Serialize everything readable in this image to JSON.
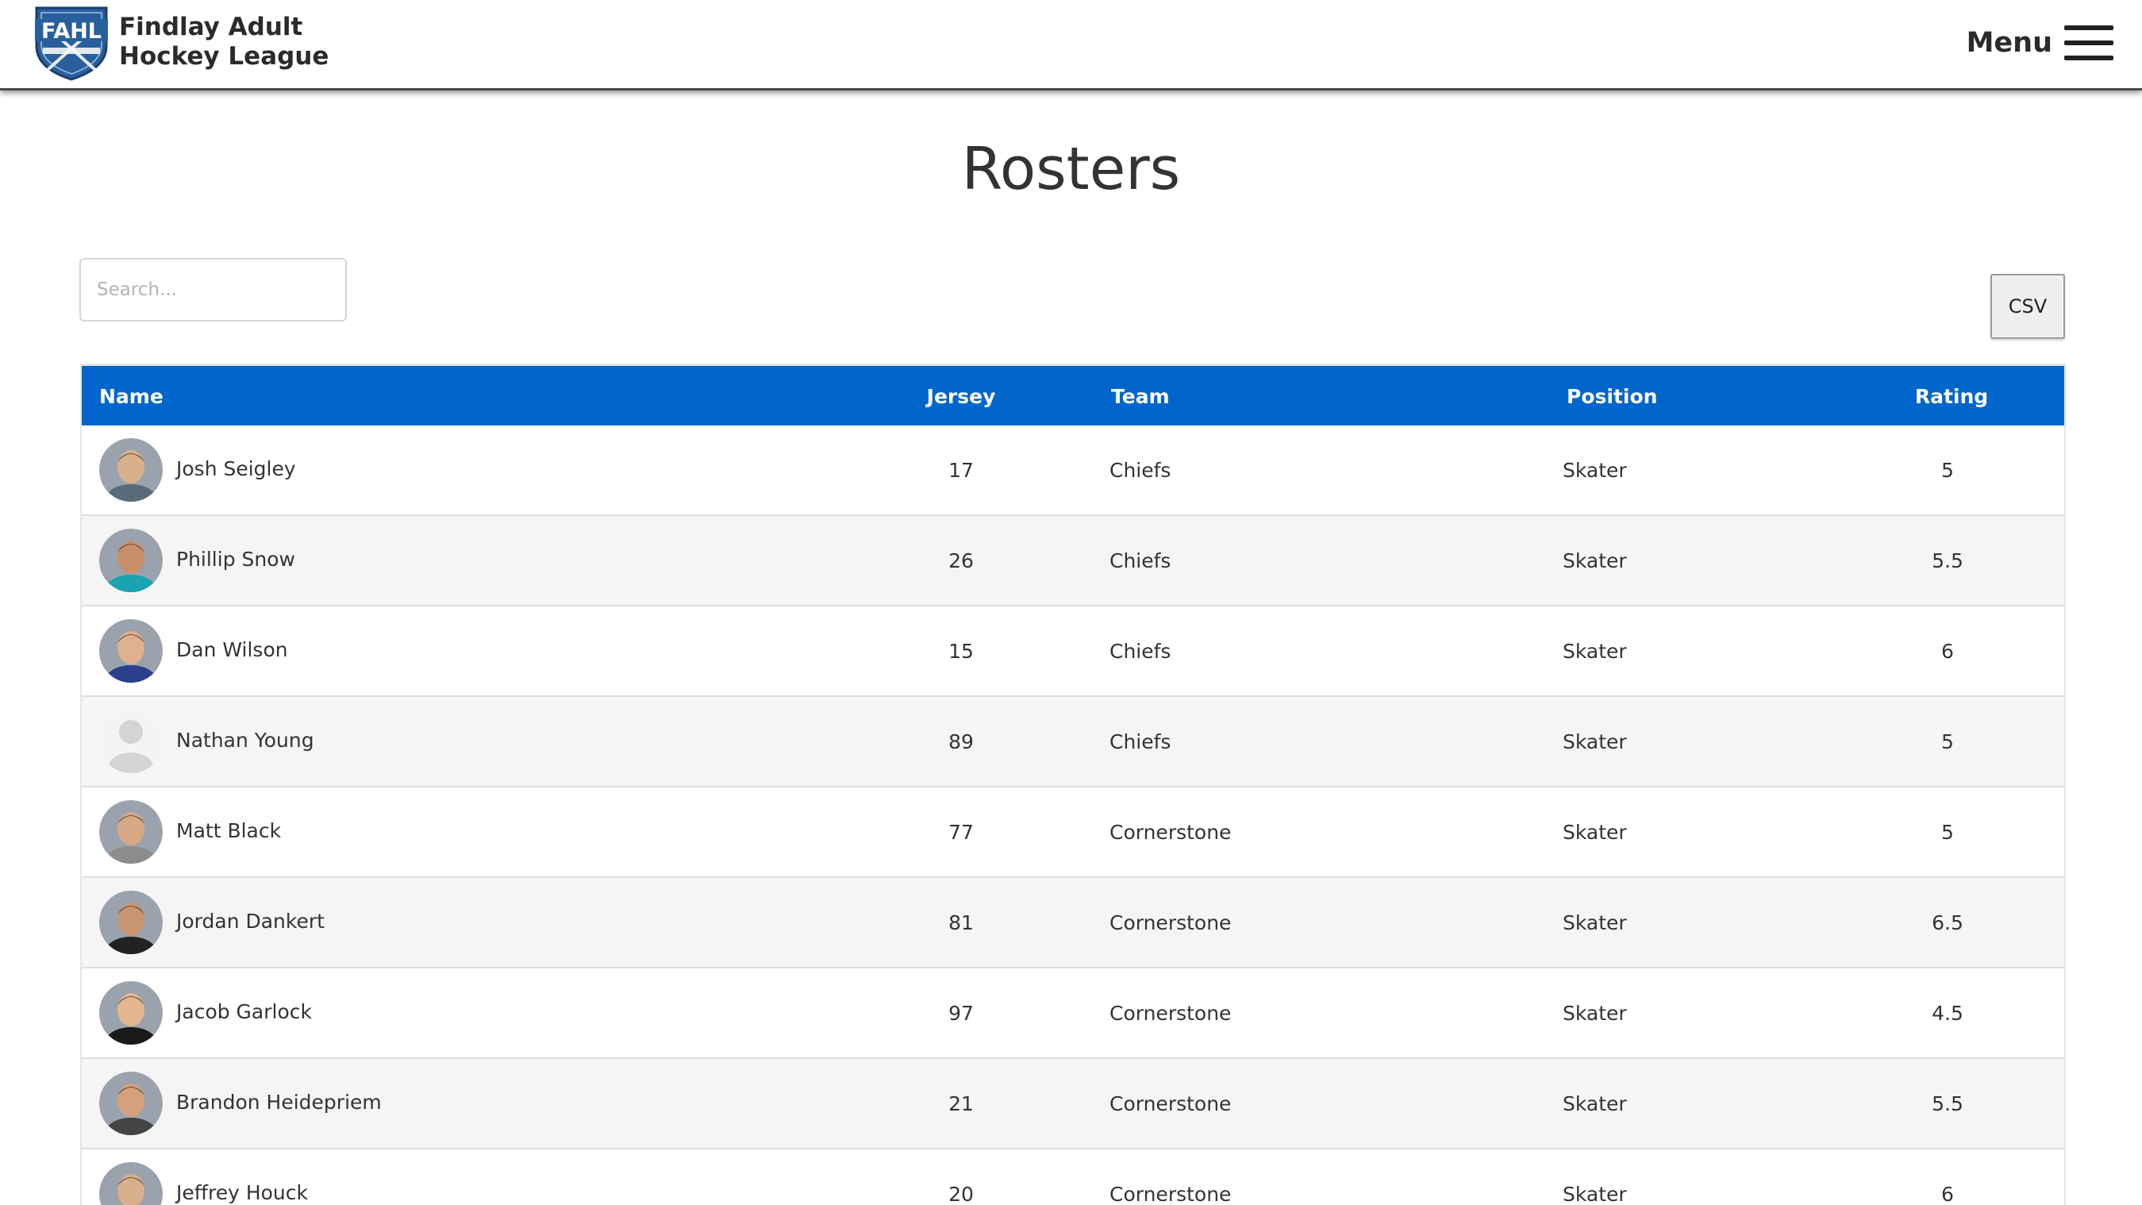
{
  "header": {
    "logo_text": "FAHL",
    "brand_line1": "Findlay Adult",
    "brand_line2": "Hockey League",
    "menu_label": "Menu"
  },
  "page": {
    "title": "Rosters"
  },
  "search": {
    "placeholder": "Search...",
    "value": ""
  },
  "actions": {
    "csv_label": "CSV"
  },
  "table": {
    "headers": {
      "name": "Name",
      "jersey": "Jersey",
      "team": "Team",
      "position": "Position",
      "rating": "Rating"
    },
    "rows": [
      {
        "name": "Josh Seigley",
        "jersey": "17",
        "team": "Chiefs",
        "position": "Skater",
        "rating": "5",
        "avatar": "photo"
      },
      {
        "name": "Phillip Snow",
        "jersey": "26",
        "team": "Chiefs",
        "position": "Skater",
        "rating": "5.5",
        "avatar": "photo"
      },
      {
        "name": "Dan Wilson",
        "jersey": "15",
        "team": "Chiefs",
        "position": "Skater",
        "rating": "6",
        "avatar": "photo"
      },
      {
        "name": "Nathan Young",
        "jersey": "89",
        "team": "Chiefs",
        "position": "Skater",
        "rating": "5",
        "avatar": "placeholder"
      },
      {
        "name": "Matt Black",
        "jersey": "77",
        "team": "Cornerstone",
        "position": "Skater",
        "rating": "5",
        "avatar": "photo"
      },
      {
        "name": "Jordan Dankert",
        "jersey": "81",
        "team": "Cornerstone",
        "position": "Skater",
        "rating": "6.5",
        "avatar": "photo"
      },
      {
        "name": "Jacob Garlock",
        "jersey": "97",
        "team": "Cornerstone",
        "position": "Skater",
        "rating": "4.5",
        "avatar": "photo"
      },
      {
        "name": "Brandon Heidepriem",
        "jersey": "21",
        "team": "Cornerstone",
        "position": "Skater",
        "rating": "5.5",
        "avatar": "photo"
      },
      {
        "name": "Jeffrey Houck",
        "jersey": "20",
        "team": "Cornerstone",
        "position": "Skater",
        "rating": "6",
        "avatar": "photo"
      }
    ]
  },
  "colors": {
    "header_blue": "#0066cc",
    "row_alt": "#f5f5f5",
    "logo_blue": "#2a5f9e"
  }
}
